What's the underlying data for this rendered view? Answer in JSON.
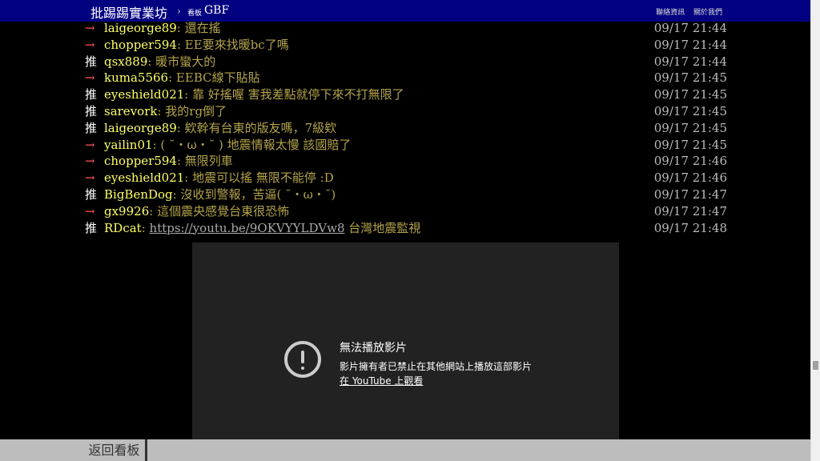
{
  "header": {
    "site_title": "批踢踢實業坊",
    "separator": "›",
    "board_prefix": "看板",
    "board_name": "GBF",
    "links": [
      "聯絡資訊",
      "關於我們"
    ]
  },
  "comments": [
    {
      "tag": "→",
      "userid": "laigeorge89",
      "content": ": 還在搖",
      "time": "09/17 21:44"
    },
    {
      "tag": "→",
      "userid": "chopper594",
      "content": ": EE要來找暖bc了嗎",
      "time": "09/17 21:44"
    },
    {
      "tag": "推",
      "userid": "qsx889",
      "content": ": 暖市蠻大的",
      "time": "09/17 21:44"
    },
    {
      "tag": "→",
      "userid": "kuma5566",
      "content": ": EEBC線下貼貼",
      "time": "09/17 21:45"
    },
    {
      "tag": "推",
      "userid": "eyeshield021",
      "content": ": 靠 好搖喔 害我差點就停下來不打無限了",
      "time": "09/17 21:45"
    },
    {
      "tag": "推",
      "userid": "sarevork",
      "content": ": 我的rg倒了",
      "time": "09/17 21:45"
    },
    {
      "tag": "推",
      "userid": "laigeorge89",
      "content": ": 欸幹有台東的版友嗎，7級欸",
      "time": "09/17 21:45"
    },
    {
      "tag": "→",
      "userid": "yailin01",
      "content": ": ( ˘・ω・˘ ) 地震情報太慢 該國賠了",
      "time": "09/17 21:45"
    },
    {
      "tag": "→",
      "userid": "chopper594",
      "content": ": 無限列車",
      "time": "09/17 21:46"
    },
    {
      "tag": "→",
      "userid": "eyeshield021",
      "content": ": 地震可以搖 無限不能停 :D",
      "time": "09/17 21:46"
    },
    {
      "tag": "推",
      "userid": "BigBenDog",
      "content": ": 沒收到警報，苦逼( ˘・ω・˘)",
      "time": "09/17 21:47"
    },
    {
      "tag": "→",
      "userid": "gx9926",
      "content": ": 這個震央感覺台東很恐怖",
      "time": "09/17 21:47"
    },
    {
      "tag": "推",
      "userid": "RDcat",
      "content_prefix": ": ",
      "link": "https://youtu.be/9OKVYYLDVw8",
      "content_suffix": " 台灣地震監視",
      "time": "09/17 21:48"
    }
  ],
  "video": {
    "icon": "error-icon",
    "title": "無法播放影片",
    "message": "影片擁有者已禁止在其他網站上播放這部影片",
    "link": "在 YouTube 上觀看"
  },
  "footer": {
    "back_label": "返回看板"
  },
  "colors": {
    "header_bg": "#000080",
    "userid": "#ffff66",
    "content": "#b3a34b",
    "push_arrow": "#ff5555"
  }
}
